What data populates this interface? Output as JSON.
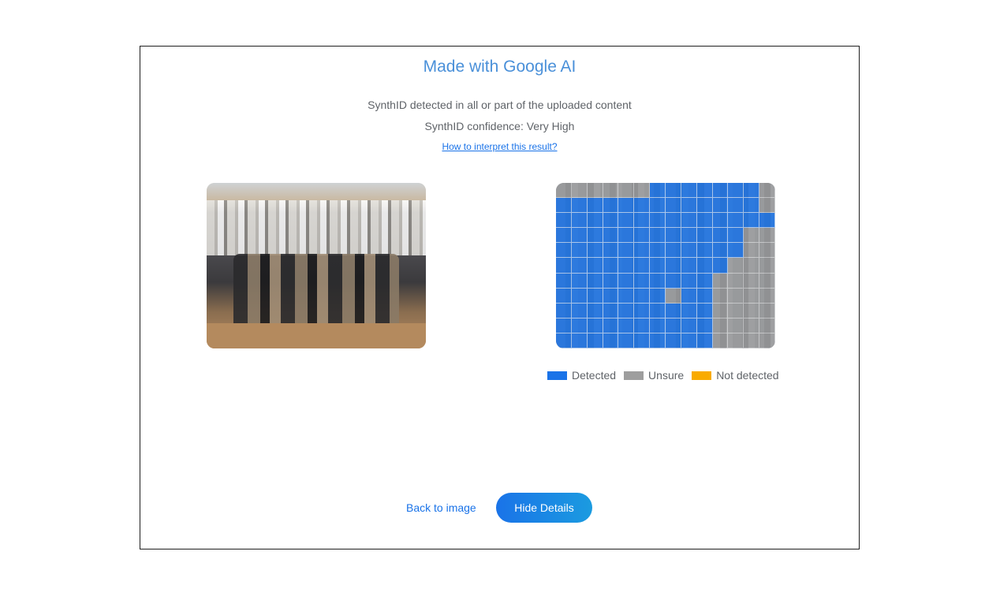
{
  "result": {
    "title": "Made with Google AI",
    "detection_text": "SynthID detected in all or part of the uploaded content",
    "confidence_text": "SynthID confidence: Very High",
    "help_link": "How to interpret this result?"
  },
  "heatmap": {
    "colors": {
      "detected": "#1a73e8",
      "unsure": "#9e9e9e",
      "not_detected": "#f9ab00"
    },
    "grid": [
      "UUUUUUDDDDDDDU",
      "DDDDDDDDDDDDDU",
      "DDDDDDDDDDDDDD",
      "DDDDDDDDDDDDUU",
      "DDDDDDDDDDDDUU",
      "DDDDDDDDDDDUUU",
      "DDDDDDDDDDUUUU",
      "DDDDDDDUDDUUUU",
      "DDDDDDDDDDUUUU",
      "DDDDDDDDDDUUUU",
      "DDDDDDDDDDUUUU"
    ]
  },
  "legend": [
    {
      "label": "Detected",
      "color": "#1a73e8"
    },
    {
      "label": "Unsure",
      "color": "#9e9e9e"
    },
    {
      "label": "Not detected",
      "color": "#f9ab00"
    }
  ],
  "actions": {
    "back_label": "Back to image",
    "hide_label": "Hide Details"
  }
}
